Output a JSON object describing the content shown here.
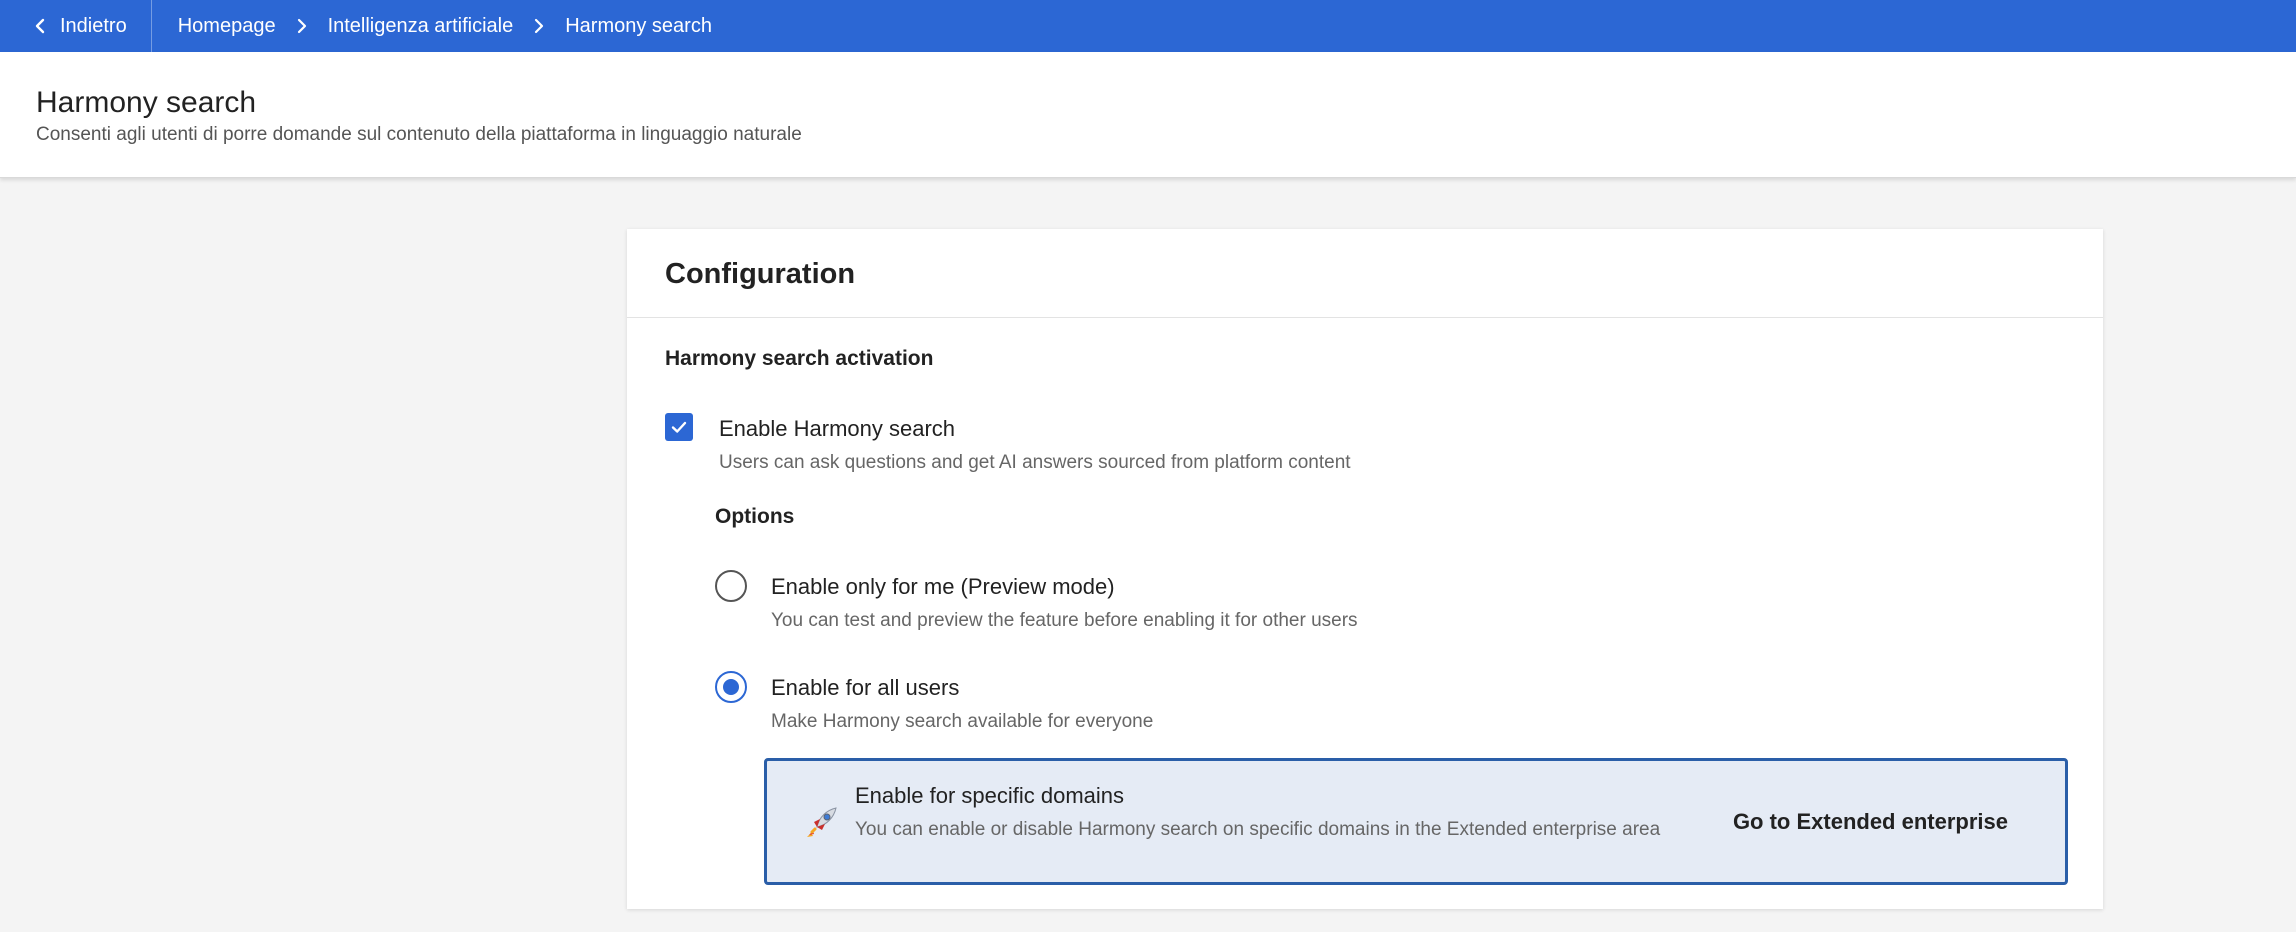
{
  "topbar": {
    "back_label": "Indietro",
    "breadcrumbs": [
      "Homepage",
      "Intelligenza artificiale",
      "Harmony search"
    ],
    "background_color": "#2c67d4"
  },
  "header": {
    "title": "Harmony search",
    "subtitle": "Consenti agli utenti di porre domande sul contenuto della piattaforma in linguaggio naturale"
  },
  "card": {
    "title": "Configuration",
    "section_title": "Harmony search activation",
    "enable": {
      "label": "Enable Harmony search",
      "description": "Users can ask questions and get AI answers sourced from platform content",
      "checked": true
    },
    "options_title": "Options",
    "options": [
      {
        "label": "Enable only for me (Preview mode)",
        "description": "You can test and preview the feature before enabling it for other users",
        "selected": false
      },
      {
        "label": "Enable for all users",
        "description": "Make Harmony search available for everyone",
        "selected": true
      }
    ],
    "domains_box": {
      "icon": "rocket-icon",
      "title": "Enable for specific domains",
      "description": "You can enable or disable Harmony search on specific domains in the Extended enterprise area",
      "link_label": "Go to Extended enterprise"
    }
  }
}
